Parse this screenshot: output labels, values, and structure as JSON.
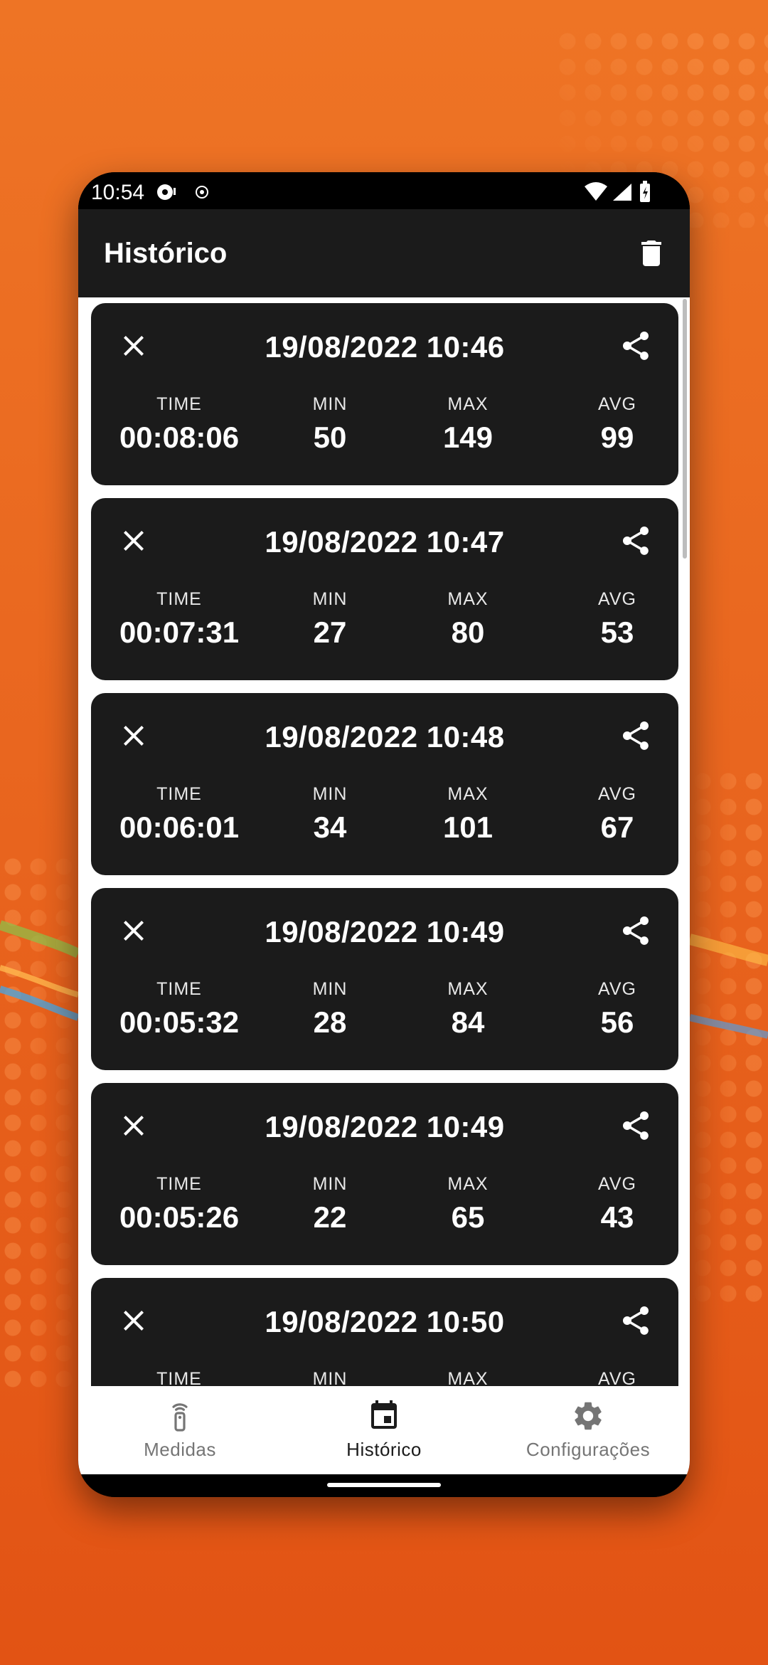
{
  "status_bar": {
    "time": "10:54"
  },
  "app_bar": {
    "title": "Histórico"
  },
  "labels": {
    "time": "TIME",
    "min": "MIN",
    "max": "MAX",
    "avg": "AVG"
  },
  "records": [
    {
      "date": "19/08/2022 10:46",
      "time": "00:08:06",
      "min": "50",
      "max": "149",
      "avg": "99"
    },
    {
      "date": "19/08/2022 10:47",
      "time": "00:07:31",
      "min": "27",
      "max": "80",
      "avg": "53"
    },
    {
      "date": "19/08/2022 10:48",
      "time": "00:06:01",
      "min": "34",
      "max": "101",
      "avg": "67"
    },
    {
      "date": "19/08/2022 10:49",
      "time": "00:05:32",
      "min": "28",
      "max": "84",
      "avg": "56"
    },
    {
      "date": "19/08/2022 10:49",
      "time": "00:05:26",
      "min": "22",
      "max": "65",
      "avg": "43"
    },
    {
      "date": "19/08/2022 10:50",
      "time": "",
      "min": "",
      "max": "",
      "avg": ""
    }
  ],
  "bottom_nav": [
    {
      "label": "Medidas",
      "icon": "remote-signal-icon",
      "active": false
    },
    {
      "label": "Histórico",
      "icon": "calendar-icon",
      "active": true
    },
    {
      "label": "Configurações",
      "icon": "gear-icon",
      "active": false
    }
  ],
  "colors": {
    "background": "#EA6A20",
    "card": "#1B1B1B",
    "app_bar": "#1B1B1B",
    "nav_active": "#1B1B1B",
    "nav_inactive": "#757575"
  }
}
